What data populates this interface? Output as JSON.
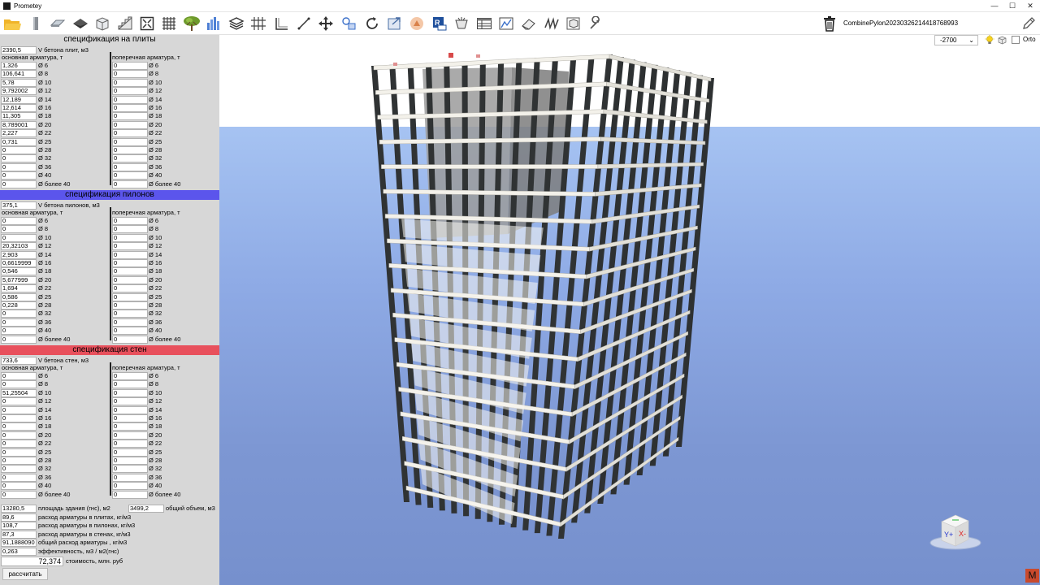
{
  "window": {
    "title": "Prometey",
    "minimize": "—",
    "maximize": "☐",
    "close": "✕"
  },
  "toolbar": {
    "icons": [
      "open-folder-icon",
      "column-icon",
      "slab-icon",
      "view-icon",
      "box-icon",
      "stair-icon",
      "fit-view-icon",
      "grid-icon",
      "tree-icon",
      "bar-chart-icon",
      "layers-icon",
      "axes-grid-icon",
      "angle-icon",
      "measure-icon",
      "move-icon",
      "transform-icon",
      "rotate-icon",
      "export-icon",
      "render-icon",
      "revit-export-icon",
      "cup-icon",
      "table-icon",
      "stats-icon",
      "eraser-icon",
      "spring-icon",
      "snap-icon",
      "wrench-icon"
    ],
    "project_name": "CombinePylon20230326214418768993",
    "delete_icon": "trash-icon",
    "edit_icon": "pencil-icon"
  },
  "viewport": {
    "level": "-2700",
    "ortho_label": "Orto",
    "ortho_checked": false,
    "nav_cube": {
      "y": "Y+",
      "x": "X-"
    },
    "badge": "M"
  },
  "colors": {
    "slabs_header": "#d7d7d7",
    "pylons_header": "#5b55ec",
    "walls_header": "#e8505c",
    "ground": "#8eaae5",
    "badge": "#c94a2d"
  },
  "sections": [
    {
      "key": "slabs",
      "title": "спецификация на плиты",
      "volume": "2390,5",
      "volume_label": "V бетона плит, м3",
      "main_label": "основная арматура, т",
      "trans_label": "поперечная арматура, т",
      "diameters": [
        "Ø 6",
        "Ø 8",
        "Ø 10",
        "Ø 12",
        "Ø 14",
        "Ø 16",
        "Ø 18",
        "Ø 20",
        "Ø 22",
        "Ø 25",
        "Ø 28",
        "Ø 32",
        "Ø 36",
        "Ø 40",
        "Ø более 40"
      ],
      "main": [
        "1,326",
        "106,641",
        "5,78",
        "9,792002",
        "12,189",
        "12,614",
        "11,305",
        "8,789001",
        "2,227",
        "0,731",
        "0",
        "0",
        "0",
        "0",
        "0"
      ],
      "trans": [
        "0",
        "0",
        "0",
        "0",
        "0",
        "0",
        "0",
        "0",
        "0",
        "0",
        "0",
        "0",
        "0",
        "0",
        "0"
      ]
    },
    {
      "key": "pylons",
      "title": "спецификация пилонов",
      "volume": "375,1",
      "volume_label": "V бетона пилонов, м3",
      "main_label": "основная арматура, т",
      "trans_label": "поперечная арматура, т",
      "diameters": [
        "Ø 6",
        "Ø 8",
        "Ø 10",
        "Ø 12",
        "Ø 14",
        "Ø 16",
        "Ø 18",
        "Ø 20",
        "Ø 22",
        "Ø 25",
        "Ø 28",
        "Ø 32",
        "Ø 36",
        "Ø 40",
        "Ø более 40"
      ],
      "main": [
        "0",
        "0",
        "0",
        "20,32103",
        "2,903",
        "0,6619999",
        "0,546",
        "5,677999",
        "1,694",
        "0,586",
        "0,228",
        "0",
        "0",
        "0",
        "0"
      ],
      "trans": [
        "0",
        "0",
        "0",
        "0",
        "0",
        "0",
        "0",
        "0",
        "0",
        "0",
        "0",
        "0",
        "0",
        "0",
        "0"
      ]
    },
    {
      "key": "walls",
      "title": "спецификация стен",
      "volume": "733,6",
      "volume_label": "V бетона стен, м3",
      "main_label": "основная арматура, т",
      "trans_label": "поперечная арматура, т",
      "diameters": [
        "Ø 6",
        "Ø 8",
        "Ø 10",
        "Ø 12",
        "Ø 14",
        "Ø 16",
        "Ø 18",
        "Ø 20",
        "Ø 22",
        "Ø 25",
        "Ø 28",
        "Ø 32",
        "Ø 36",
        "Ø 40",
        "Ø более 40"
      ],
      "main": [
        "0",
        "0",
        "51,25504",
        "0",
        "0",
        "0",
        "0",
        "0",
        "0",
        "0",
        "0",
        "0",
        "0",
        "0",
        "0"
      ],
      "trans": [
        "0",
        "0",
        "0",
        "0",
        "0",
        "0",
        "0",
        "0",
        "0",
        "0",
        "0",
        "0",
        "0",
        "0",
        "0"
      ]
    }
  ],
  "summary": {
    "area": "13280,5",
    "area_label": "площадь здания (гнс), м2",
    "total_volume": "3499,2",
    "total_volume_label": "общий объем, м3",
    "rows": [
      {
        "value": "89,6",
        "label": "расход арматуры в плитах, кг/м3"
      },
      {
        "value": "108,7",
        "label": "расход арматуры в пилонах, кг/м3"
      },
      {
        "value": "87,3",
        "label": "расход арматуры в стенах, кг/м3"
      },
      {
        "value": "91,1888090",
        "label": "общий расход арматуры , кг/м3"
      },
      {
        "value": "0,263",
        "label": "эффективность, м3 / м2(гнс)"
      }
    ],
    "cost": "72,374",
    "cost_label": "стоимость, млн. руб",
    "calc_button": "рассчитать"
  }
}
